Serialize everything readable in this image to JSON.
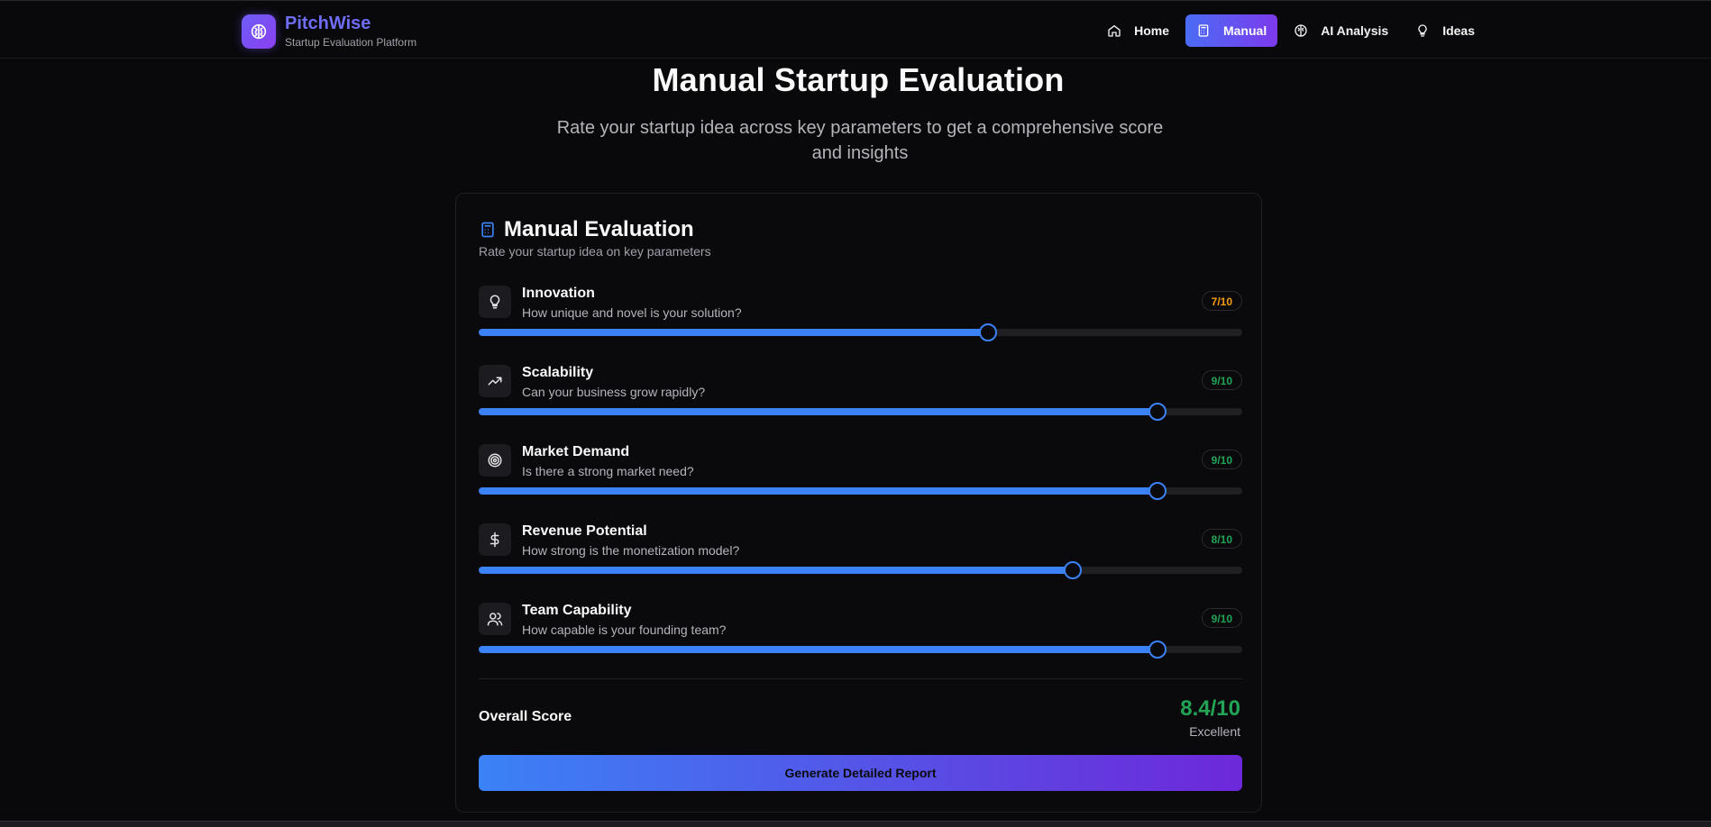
{
  "brand": {
    "name": "PitchWise",
    "tagline": "Startup Evaluation Platform"
  },
  "nav": [
    {
      "label": "Home",
      "icon": "home-icon",
      "active": false
    },
    {
      "label": "Manual",
      "icon": "calculator-icon",
      "active": true
    },
    {
      "label": "AI Analysis",
      "icon": "brain-icon",
      "active": false
    },
    {
      "label": "Ideas",
      "icon": "lightbulb-icon",
      "active": false
    }
  ],
  "hero": {
    "title": "Manual Startup Evaluation",
    "subtitle": "Rate your startup idea across key parameters to get a comprehensive score and insights"
  },
  "card": {
    "title": "Manual Evaluation",
    "subtitle": "Rate your startup idea on key parameters",
    "parameters": [
      {
        "name": "Innovation",
        "question": "How unique and novel is your solution?",
        "score": 7,
        "max": 10,
        "badge": "7/10",
        "badge_color": "#f59e0b",
        "icon": "lightbulb-icon"
      },
      {
        "name": "Scalability",
        "question": "Can your business grow rapidly?",
        "score": 9,
        "max": 10,
        "badge": "9/10",
        "badge_color": "#22a355",
        "icon": "trending-up-icon"
      },
      {
        "name": "Market Demand",
        "question": "Is there a strong market need?",
        "score": 9,
        "max": 10,
        "badge": "9/10",
        "badge_color": "#22a355",
        "icon": "target-icon"
      },
      {
        "name": "Revenue Potential",
        "question": "How strong is the monetization model?",
        "score": 8,
        "max": 10,
        "badge": "8/10",
        "badge_color": "#22a355",
        "icon": "dollar-icon"
      },
      {
        "name": "Team Capability",
        "question": "How capable is your founding team?",
        "score": 9,
        "max": 10,
        "badge": "9/10",
        "badge_color": "#22a355",
        "icon": "users-icon"
      }
    ],
    "overall": {
      "label": "Overall Score",
      "score": "8.4/10",
      "rating": "Excellent"
    },
    "button_label": "Generate Detailed Report"
  },
  "colors": {
    "accent": "#3b82f6",
    "brand": "#6f6df6",
    "success": "#22a355",
    "warning": "#f59e0b"
  }
}
